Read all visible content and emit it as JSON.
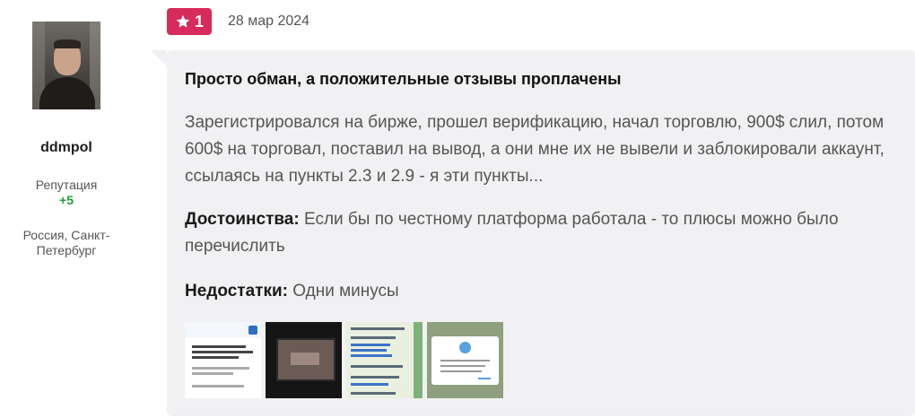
{
  "author": {
    "username": "ddmpol",
    "reputation_label": "Репутация",
    "reputation_value": "+5",
    "location": "Россия, Санкт-Петербург"
  },
  "review": {
    "rating": "1",
    "date": "28 мар 2024",
    "title": "Просто обман, а положительные отзывы проплачены",
    "text": "Зарегистрировался на бирже, прошел верификацию, начал торговлю, 900$ слил, потом 600$ на торговал, поставил на вывод, а они мне их не вывели и заблокировали аккаунт, ссылаясь на пункты 2.3 и 2.9 - я эти пункты...",
    "pros_label": "Достоинства:",
    "pros_text": " Если бы по честному платформа работала - то плюсы можно было перечислить",
    "cons_label": "Недостатки:",
    "cons_text": " Одни минусы"
  },
  "colors": {
    "badge": "#d62b5b",
    "card_bg": "#f1f1f3",
    "reputation_positive": "#1e9e3a"
  },
  "icons": {
    "rating": "star-icon"
  }
}
